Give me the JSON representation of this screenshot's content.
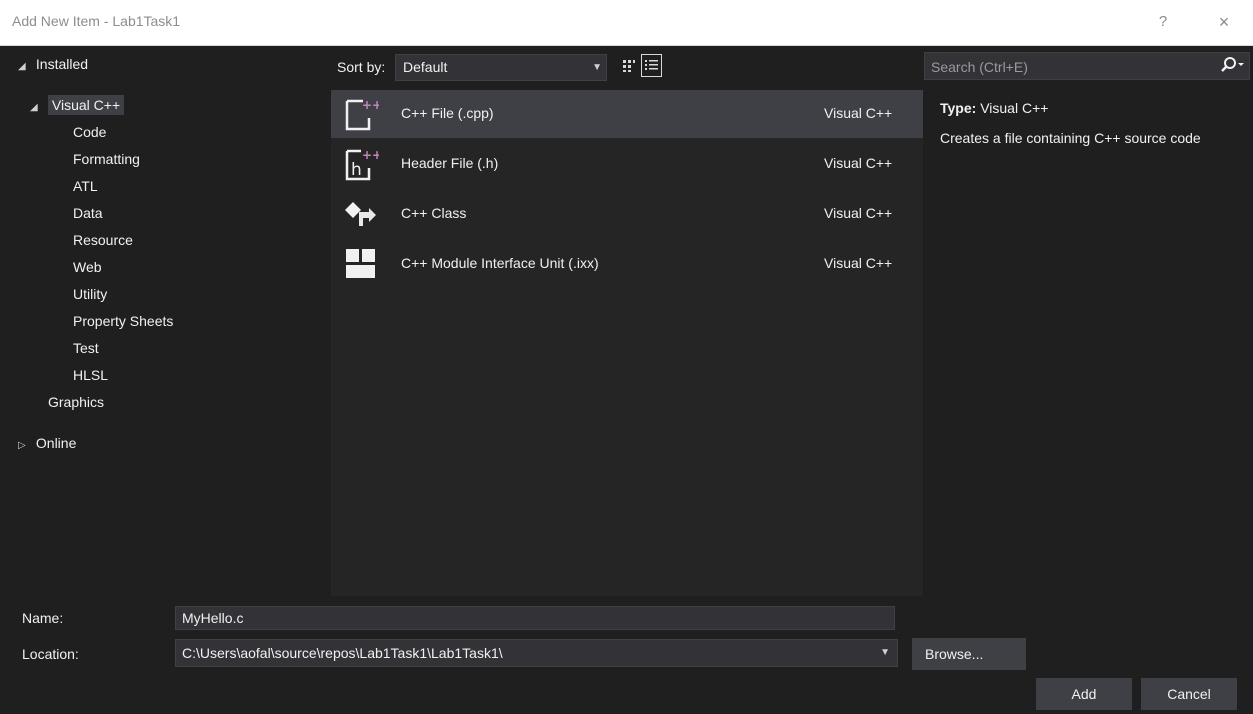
{
  "window": {
    "title": "Add New Item - Lab1Task1",
    "help_glyph": "?",
    "close_glyph": "×"
  },
  "tree": {
    "installed_label": "Installed",
    "visual_cpp_label": "Visual C++",
    "children": [
      "Code",
      "Formatting",
      "ATL",
      "Data",
      "Resource",
      "Web",
      "Utility",
      "Property Sheets",
      "Test",
      "HLSL"
    ],
    "graphics_label": "Graphics",
    "online_label": "Online"
  },
  "toolbar": {
    "sort_label": "Sort by:",
    "sort_value": "Default"
  },
  "items": [
    {
      "name": "C++ File (.cpp)",
      "type": "Visual C++",
      "icon": "cpp-file-icon"
    },
    {
      "name": "Header File (.h)",
      "type": "Visual C++",
      "icon": "header-file-icon"
    },
    {
      "name": "C++ Class",
      "type": "Visual C++",
      "icon": "cpp-class-icon"
    },
    {
      "name": "C++ Module Interface Unit (.ixx)",
      "type": "Visual C++",
      "icon": "module-unit-icon"
    }
  ],
  "search": {
    "placeholder": "Search (Ctrl+E)"
  },
  "details": {
    "type_label": "Type:",
    "type_value": "Visual C++",
    "description": "Creates a file containing C++ source code"
  },
  "form": {
    "name_label": "Name:",
    "name_value": "MyHello.c",
    "location_label": "Location:",
    "location_value": "C:\\Users\\aofal\\source\\repos\\Lab1Task1\\Lab1Task1\\"
  },
  "buttons": {
    "browse": "Browse...",
    "add": "Add",
    "cancel": "Cancel"
  },
  "colors": {
    "background": "#1f1f1f",
    "list_background": "#252526",
    "selection": "#3f3f46",
    "accent_icon": "#b180d7"
  }
}
